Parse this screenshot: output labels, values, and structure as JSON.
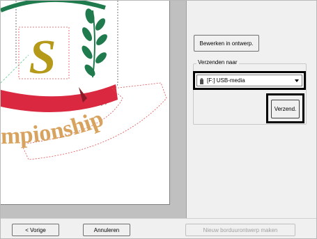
{
  "toolbar": {
    "edit_label": "Bewerken in ontwerp."
  },
  "send_group": {
    "label": "Verzenden naar",
    "destination": {
      "selected": "[F:] USB-media",
      "icon": "usb-drive-icon"
    },
    "send_label": "Verzend."
  },
  "footer": {
    "back_label": "< Vorige",
    "cancel_label": "Annuleren",
    "new_design_label": "Nieuw borduurontwerp maken"
  },
  "preview": {
    "monogram_letter": "S",
    "arc_text": "mpionship",
    "colors": {
      "gold": "#b59a19",
      "green": "#1f7a4d",
      "red": "#d9283f",
      "arc_text": "#d7a35e"
    }
  }
}
